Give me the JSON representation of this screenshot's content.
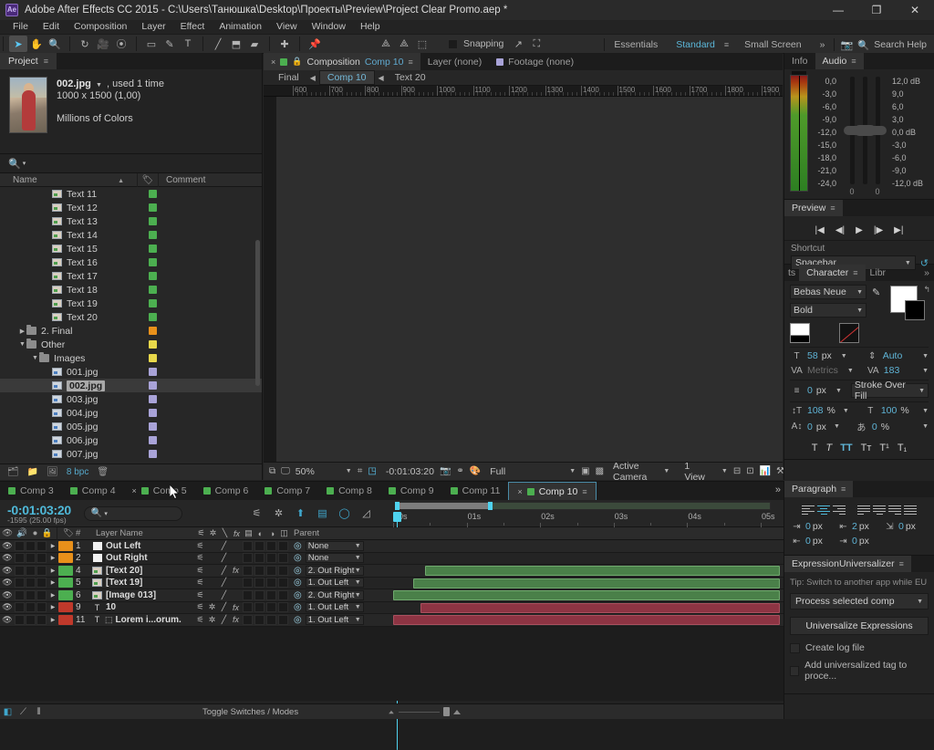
{
  "window": {
    "app_title": "Adobe After Effects CC 2015 - C:\\Users\\Танюшка\\Desktop\\Проекты\\Preview\\Project Clear Promo.aep *",
    "logo": "Ae",
    "minimize": "—",
    "maximize": "❐",
    "close": "✕"
  },
  "menu": [
    "File",
    "Edit",
    "Composition",
    "Layer",
    "Effect",
    "Animation",
    "View",
    "Window",
    "Help"
  ],
  "toolbar": {
    "tools": [
      {
        "name": "selection-tool",
        "glyph": "➤",
        "active": true
      },
      {
        "name": "hand-tool",
        "glyph": "✋"
      },
      {
        "name": "zoom-tool",
        "glyph": "🔍"
      },
      {
        "name": "rotation-tool",
        "glyph": "↻"
      },
      {
        "name": "camera-tool",
        "glyph": "🎥"
      },
      {
        "name": "pan-behind-tool",
        "glyph": "⦿"
      },
      {
        "name": "shape-tool",
        "glyph": "▭"
      },
      {
        "name": "pen-tool",
        "glyph": "✎"
      },
      {
        "name": "type-tool",
        "glyph": "T"
      },
      {
        "name": "brush-tool",
        "glyph": "╱"
      },
      {
        "name": "clone-stamp-tool",
        "glyph": "⬒"
      },
      {
        "name": "eraser-tool",
        "glyph": "▰"
      },
      {
        "name": "roto-brush-tool",
        "glyph": "✚"
      },
      {
        "name": "puppet-pin-tool",
        "glyph": "📌"
      },
      {
        "name": "anchor-tool-a",
        "glyph": "⟁"
      },
      {
        "name": "anchor-tool-b",
        "glyph": "⟁"
      },
      {
        "name": "anchor-tool-c",
        "glyph": "⬚"
      }
    ],
    "snapping_label": "Snapping",
    "snap_extra1": "↗",
    "snap_extra2": "⛶"
  },
  "workspaces": {
    "items": [
      "Essentials",
      "Standard",
      "Small Screen"
    ],
    "selected": "Standard",
    "overflow": "»",
    "search_placeholder": "Search Help",
    "search_icon": "search-icon"
  },
  "project": {
    "tab_label": "Project",
    "menu_glyph": "≡",
    "selected_asset": {
      "name": "002.jpg",
      "usage": ", used 1 time",
      "dimensions": "1000 x 1500 (1,00)",
      "colors": "Millions of Colors"
    },
    "search_placeholder": "",
    "columns": {
      "name": "Name",
      "comment": "Comment",
      "tag_icon": "tag-icon",
      "sort_icon": "▲"
    },
    "items": [
      {
        "label": "Text 11",
        "indent": 3,
        "type": "comp",
        "color": "#4caf50"
      },
      {
        "label": "Text 12",
        "indent": 3,
        "type": "comp",
        "color": "#4caf50"
      },
      {
        "label": "Text 13",
        "indent": 3,
        "type": "comp",
        "color": "#4caf50"
      },
      {
        "label": "Text 14",
        "indent": 3,
        "type": "comp",
        "color": "#4caf50"
      },
      {
        "label": "Text 15",
        "indent": 3,
        "type": "comp",
        "color": "#4caf50"
      },
      {
        "label": "Text 16",
        "indent": 3,
        "type": "comp",
        "color": "#4caf50"
      },
      {
        "label": "Text 17",
        "indent": 3,
        "type": "comp",
        "color": "#4caf50"
      },
      {
        "label": "Text 18",
        "indent": 3,
        "type": "comp",
        "color": "#4caf50"
      },
      {
        "label": "Text 19",
        "indent": 3,
        "type": "comp",
        "color": "#4caf50"
      },
      {
        "label": "Text 20",
        "indent": 3,
        "type": "comp",
        "color": "#4caf50"
      },
      {
        "label": "2. Final",
        "indent": 1,
        "type": "folder",
        "color": "#e8901a",
        "arrow": "▶"
      },
      {
        "label": "Other",
        "indent": 1,
        "type": "folder",
        "color": "#e8d84a",
        "arrow": "▼"
      },
      {
        "label": "Images",
        "indent": 2,
        "type": "folder",
        "color": "#e8d84a",
        "arrow": "▼"
      },
      {
        "label": "001.jpg",
        "indent": 3,
        "type": "image",
        "color": "#a9a3d8"
      },
      {
        "label": "002.jpg",
        "indent": 3,
        "type": "image",
        "color": "#a9a3d8",
        "selected": true
      },
      {
        "label": "003.jpg",
        "indent": 3,
        "type": "image",
        "color": "#a9a3d8"
      },
      {
        "label": "004.jpg",
        "indent": 3,
        "type": "image",
        "color": "#a9a3d8"
      },
      {
        "label": "005.jpg",
        "indent": 3,
        "type": "image",
        "color": "#a9a3d8"
      },
      {
        "label": "006.jpg",
        "indent": 3,
        "type": "image",
        "color": "#a9a3d8"
      },
      {
        "label": "007.jpg",
        "indent": 3,
        "type": "image",
        "color": "#a9a3d8"
      }
    ],
    "footer": {
      "bit_depth": "8 bpc",
      "new_folder_icon": "new-folder-icon",
      "new_comp_icon": "new-composition-icon",
      "interpret_icon": "interpret-footage-icon",
      "delete_icon": "delete-icon"
    }
  },
  "composition": {
    "tabs": [
      {
        "label": "Composition",
        "value": "Comp 10",
        "active": true,
        "close": "×",
        "swatch": "#4caf50",
        "lock": "lock-icon",
        "menu": "≡"
      },
      {
        "label": "Layer (none)",
        "active": false
      },
      {
        "label": "Footage (none)",
        "active": false,
        "swatch": "#a9a3d8"
      }
    ],
    "breadcrumb": [
      {
        "label": "Final",
        "active": false
      },
      {
        "label": "Comp 10",
        "active": true
      },
      {
        "label": "Text 20",
        "active": false
      }
    ],
    "breadcrumb_arrow": "◀",
    "ruler_labels": [
      "600",
      "700",
      "800",
      "900",
      "1000",
      "1100",
      "1200",
      "1300",
      "1400",
      "1500",
      "1600",
      "1700",
      "1800",
      "1900"
    ],
    "footer": {
      "zoom": "50%",
      "timecode": "-0:01:03:20",
      "resolution": "Full",
      "camera": "Active Camera",
      "views": "1 View",
      "magnify_icon": "magnification-icon",
      "monitor_icon": "monitor-icon",
      "region_icon": "region-of-interest-icon",
      "transparency_icon": "transparency-grid-icon",
      "snapshot_icon": "snapshot-icon",
      "show_snapshot_icon": "show-snapshot-icon",
      "channel_icon": "channel-icon",
      "mask_icon": "mask-icon",
      "grid_icon": "grid-icon",
      "timeline_icon": "timeline-icon",
      "comp_flow_icon": "comp-flowchart-icon",
      "exposure_icon": "exposure-icon",
      "renderer_icon": "fast-previews-icon"
    }
  },
  "info_audio": {
    "tabs": [
      {
        "label": "Info"
      },
      {
        "label": "Audio",
        "active": true
      }
    ],
    "menu_glyph": "≡",
    "left_scale": [
      "0,0",
      "-3,0",
      "-6,0",
      "-9,0",
      "-12,0",
      "-15,0",
      "-18,0",
      "-21,0",
      "-24,0"
    ],
    "right_scale": [
      "12,0 dB",
      "9,0",
      "6,0",
      "3,0",
      "0,0 dB",
      "-3,0",
      "-6,0",
      "-9,0",
      "-12,0 dB"
    ],
    "fader_values": [
      "0",
      "0"
    ]
  },
  "preview": {
    "tab_label": "Preview",
    "menu_glyph": "≡",
    "transport": [
      {
        "name": "first-frame-button",
        "glyph": "|◀"
      },
      {
        "name": "previous-frame-button",
        "glyph": "◀|"
      },
      {
        "name": "play-button",
        "glyph": "▶"
      },
      {
        "name": "next-frame-button",
        "glyph": "|▶"
      },
      {
        "name": "last-frame-button",
        "glyph": "▶|"
      }
    ],
    "shortcut_label": "Shortcut",
    "shortcut_value": "Spacebar",
    "reset_icon": "reset-icon"
  },
  "character": {
    "tabs": [
      {
        "label": "ts"
      },
      {
        "label": "Character",
        "active": true
      },
      {
        "label": "Libr"
      }
    ],
    "menu_glyph": "≡",
    "overflow": "»",
    "font_family": "Bebas Neue",
    "font_style": "Bold",
    "font_size": "58",
    "font_size_unit": "px",
    "leading": "Auto",
    "kerning": "Metrics",
    "tracking": "183",
    "stroke_width": "0",
    "stroke_width_unit": "px",
    "stroke_mode": "Stroke Over Fill",
    "vertical_scale": "108",
    "vertical_scale_unit": "%",
    "horizontal_scale": "100",
    "horizontal_scale_unit": "%",
    "baseline_shift": "0",
    "baseline_shift_unit": "px",
    "tsume": "0",
    "tsume_unit": "%",
    "eyedropper_icon": "eyedropper-icon",
    "style_buttons": [
      {
        "name": "faux-bold-button",
        "glyph": "T",
        "active": false
      },
      {
        "name": "faux-italic-button",
        "glyph": "T",
        "active": false
      },
      {
        "name": "all-caps-button",
        "glyph": "TT",
        "active": true
      },
      {
        "name": "small-caps-button",
        "glyph": "Tᴛ",
        "active": false
      },
      {
        "name": "superscript-button",
        "glyph": "T¹",
        "active": false
      },
      {
        "name": "subscript-button",
        "glyph": "T₁",
        "active": false
      }
    ]
  },
  "paragraph": {
    "tab_label": "Paragraph",
    "menu_glyph": "≡",
    "align_buttons": [
      {
        "name": "align-left-button",
        "active": false
      },
      {
        "name": "align-center-button",
        "active": true
      },
      {
        "name": "align-right-button",
        "active": false
      },
      {
        "name": "justify-last-left-button",
        "active": false
      },
      {
        "name": "justify-last-center-button",
        "active": false
      },
      {
        "name": "justify-last-right-button",
        "active": false
      },
      {
        "name": "justify-all-button",
        "active": false
      }
    ],
    "indent_left": "0",
    "indent_right": "0",
    "indent_first": "0",
    "space_before": "2",
    "space_after": "0",
    "unit": "px"
  },
  "expression_universalizer": {
    "tab_label": "ExpressionUniversalizer",
    "menu_glyph": "≡",
    "tip": "Tip: Switch to another app while EU i",
    "scope": "Process selected comp",
    "action_button": "Universalize Expressions",
    "checkboxes": [
      {
        "label": "Create log file",
        "checked": false
      },
      {
        "label": "Add universalized tag to proce...",
        "checked": false
      }
    ]
  },
  "timeline": {
    "tabs": [
      {
        "label": "Comp 3",
        "swatch": "#4caf50"
      },
      {
        "label": "Comp 4",
        "swatch": "#4caf50"
      },
      {
        "label": "Comp 5",
        "swatch": "#4caf50",
        "close": "×"
      },
      {
        "label": "Comp 6",
        "swatch": "#4caf50"
      },
      {
        "label": "Comp 7",
        "swatch": "#4caf50"
      },
      {
        "label": "Comp 8",
        "swatch": "#4caf50"
      },
      {
        "label": "Comp 9",
        "swatch": "#4caf50"
      },
      {
        "label": "Comp 11",
        "swatch": "#4caf50"
      },
      {
        "label": "Comp 10",
        "swatch": "#4caf50",
        "active": true,
        "close": "×",
        "menu": "≡"
      }
    ],
    "overflow": "»",
    "current_time": "-0:01:03:20",
    "frame_info": "-1595 (25.00 fps)",
    "search_placeholder": "",
    "toolbar_icons": [
      {
        "name": "composition-mini-flowchart-icon",
        "glyph": "⚟"
      },
      {
        "name": "draft-3d-icon",
        "glyph": "✲"
      },
      {
        "name": "hide-shy-layers-icon",
        "glyph": "⬆",
        "cyan": true
      },
      {
        "name": "frame-blending-icon",
        "glyph": "▤",
        "cyan": true
      },
      {
        "name": "motion-blur-icon",
        "glyph": "◯",
        "cyan": true
      },
      {
        "name": "graph-editor-icon",
        "glyph": "◿"
      }
    ],
    "column_headers": {
      "video": "video-icon",
      "audio": "audio-icon",
      "solo": "solo-icon",
      "lock": "lock-icon",
      "label": "label-icon",
      "number": "#",
      "layer_name": "Layer Name",
      "parent": "Parent"
    },
    "switch_headers": [
      "shy-icon",
      "collapse-icon",
      "quality-icon",
      "fx-icon",
      "frame-blend-icon",
      "motion-blur-icon",
      "adjustment-icon",
      "3d-icon"
    ],
    "time_labels": [
      "00s",
      "01s",
      "02s",
      "03s",
      "04s",
      "05s"
    ],
    "layers": [
      {
        "num": "1",
        "name": "Out Left",
        "color": "#e8901a",
        "icon": "solid",
        "parent": "None",
        "fx": false,
        "star": false
      },
      {
        "num": "2",
        "name": "Out Right",
        "color": "#e8901a",
        "icon": "solid",
        "parent": "None",
        "fx": false,
        "star": false
      },
      {
        "num": "4",
        "name": "[Text 20]",
        "color": "#4caf50",
        "icon": "comp",
        "parent": "2. Out Right",
        "fx": true,
        "star": false,
        "bar": {
          "start": 36,
          "color": "g"
        }
      },
      {
        "num": "5",
        "name": "[Text 19]",
        "color": "#4caf50",
        "icon": "comp",
        "parent": "1. Out Left",
        "fx": false,
        "star": false,
        "bar": {
          "start": 23,
          "color": "g"
        }
      },
      {
        "num": "6",
        "name": "[Image 013]",
        "color": "#4caf50",
        "icon": "comp",
        "parent": "2. Out Right",
        "fx": false,
        "star": false,
        "bar": {
          "start": 1,
          "color": "g"
        }
      },
      {
        "num": "9",
        "name": "10",
        "color": "#c0392b",
        "icon": "text",
        "parent": "1. Out Left",
        "fx": true,
        "star": true,
        "bar": {
          "start": 31,
          "color": "r"
        }
      },
      {
        "num": "11",
        "name": "Lorem i...orum.",
        "color": "#c0392b",
        "icon": "text",
        "parent": "1. Out Left",
        "fx": true,
        "star": true,
        "bar": {
          "start": 1,
          "color": "r"
        }
      }
    ],
    "footer": {
      "toggle_switches_label": "Toggle Switches / Modes",
      "motion_blur_icon": "motion-blur-icon",
      "graph_icon": "graph-editor-icon",
      "adjust_icon": "adjust-icon"
    }
  }
}
